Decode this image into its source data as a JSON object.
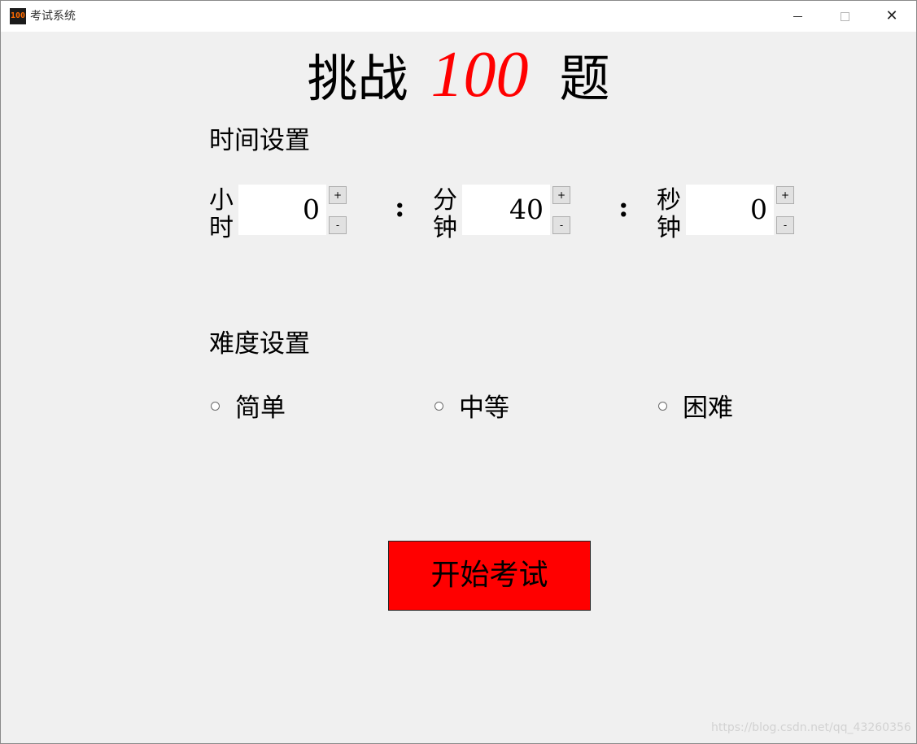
{
  "window": {
    "title": "考试系统",
    "icon": "app-logo-icon",
    "icon_text": "100",
    "controls": {
      "minimize": "minimize-icon",
      "maximize": "maximize-icon",
      "close_glyph": "✕"
    }
  },
  "headline": {
    "prefix": "挑战",
    "number": "100",
    "suffix": "题",
    "number_color": "#ff0000"
  },
  "time_settings": {
    "label": "时间设置",
    "separator": ":",
    "fields": [
      {
        "label": "小时",
        "value": "0",
        "plus": "+",
        "minus": "-"
      },
      {
        "label": "分钟",
        "value": "40",
        "plus": "+",
        "minus": "-"
      },
      {
        "label": "秒钟",
        "value": "0",
        "plus": "+",
        "minus": "-"
      }
    ]
  },
  "difficulty": {
    "label": "难度设置",
    "options": [
      {
        "label": "简单",
        "checked": false
      },
      {
        "label": "中等",
        "checked": false
      },
      {
        "label": "困难",
        "checked": false
      }
    ]
  },
  "start_button": {
    "label": "开始考试",
    "color": "#ff0000"
  },
  "watermark": "https://blog.csdn.net/qq_43260356"
}
